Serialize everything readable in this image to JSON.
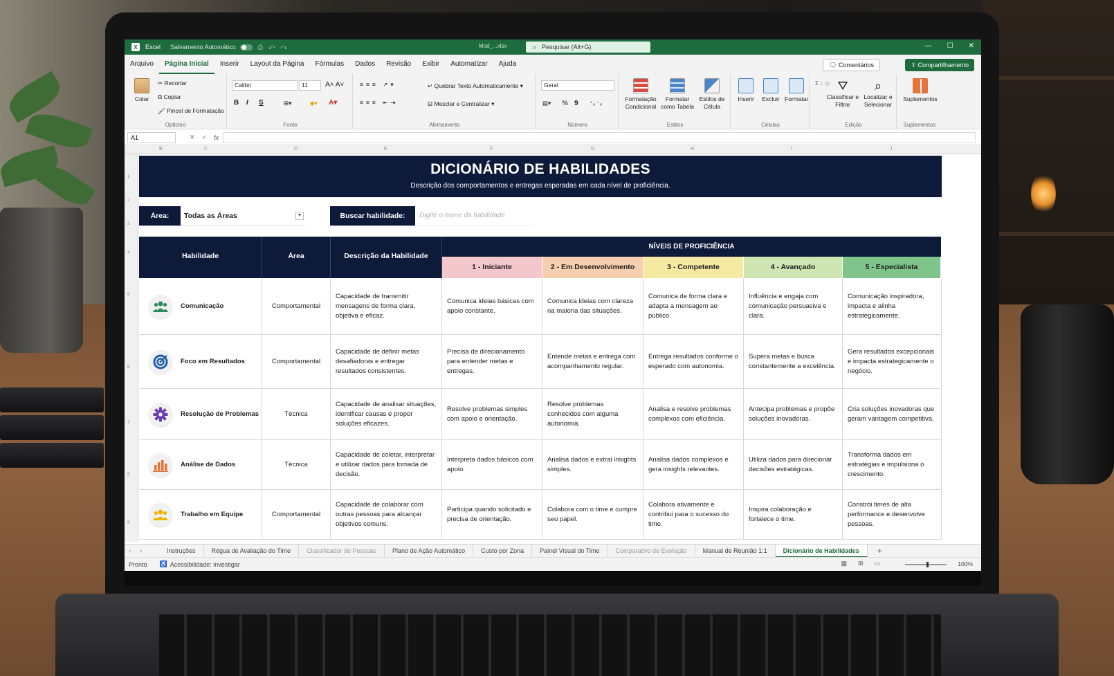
{
  "window": {
    "app_name": "Excel",
    "autosave_label": "Salvamento Automático",
    "file_name": "Mod_...xlsx",
    "search_placeholder": "Pesquisar (Alt+G)",
    "win_min": "—",
    "win_max": "☐",
    "win_close": "✕"
  },
  "menu": {
    "tabs": [
      "Arquivo",
      "Página Inicial",
      "Inserir",
      "Layout da Página",
      "Fórmulas",
      "Dados",
      "Revisão",
      "Exibir",
      "Automatizar",
      "Ajuda"
    ],
    "active_tab": "Página Inicial",
    "comments_label": "Comentários",
    "share_label": "Compartilhamento"
  },
  "ribbon": {
    "paste": "Colar",
    "cut": "Recortar",
    "copy": "Copiar",
    "format_painter": "Pincel de Formatação",
    "clipboard_group": "Opticteo",
    "font_name": "Calibri",
    "font_size": "11",
    "bold": "B",
    "italic": "I",
    "underline": "S",
    "font_group": "Fonte",
    "wrap_text": "Quebrar Texto Automaticamente",
    "merge_center": "Mesclar e Centralizar",
    "alignment_group": "Alinhamento",
    "number_format": "Geral",
    "percent": "%",
    "thousands": "9",
    "number_group": "Número",
    "cond_format": "Formatação Condicional",
    "format_table": "Formatar como Tabela",
    "cell_styles": "Estilos de Célula",
    "styles_group": "Estilos",
    "insert": "Inserir",
    "delete": "Excluir",
    "format": "Formatar",
    "cells_group": "Células",
    "sort_filter": "Classificar e Filtrar",
    "find_select": "Localizar e Selecionar",
    "editing_group": "Edição",
    "addins": "Suplementos",
    "addins_group": "Suplementos"
  },
  "formula_bar": {
    "name_box": "A1",
    "fx_label": "fx"
  },
  "sheet": {
    "title": "DICIONÁRIO DE HABILIDADES",
    "subtitle": "Descrição dos comportamentos e entregas esperadas em cada nível de proficiência.",
    "area_label": "Área:",
    "area_value": "Todas as Áreas",
    "search_label": "Buscar habilidade:",
    "search_placeholder": "Digite o nome da habilidade",
    "headers": {
      "skill": "Habilidade",
      "area": "Área",
      "description": "Descrição da Habilidade",
      "levels_title": "NÍVEIS DE PROFICIÊNCIA"
    },
    "levels": [
      {
        "label": "1 - Iniciante",
        "color": "#f4c7cc"
      },
      {
        "label": "2 - Em Desenvolvimento",
        "color": "#f8cfae"
      },
      {
        "label": "3 - Competente",
        "color": "#f6eaa3"
      },
      {
        "label": "4 - Avançado",
        "color": "#cfe6b3"
      },
      {
        "label": "5 - Especialista",
        "color": "#7fc48a"
      }
    ],
    "rows": [
      {
        "skill": "Comunicação",
        "icon": "people-icon",
        "area": "Comportamental",
        "description": "Capacidade de transmitir mensagens de forma clara, objetiva e eficaz.",
        "l1": "Comunica ideias básicas com apoio constante.",
        "l2": "Comunica ideias com clareza na maioria das situações.",
        "l3": "Comunica de forma clara e adapta a mensagem ao público.",
        "l4": "Influência e engaja com comunicação persuasiva e clara.",
        "l5": "Comunicação inspiradora, impacta e alinha estrategicamente."
      },
      {
        "skill": "Foco em Resultados",
        "icon": "target-icon",
        "area": "Comportamental",
        "description": "Capacidade de definir metas desafiadoras e entregar resultados consistentes.",
        "l1": "Precisa de direcionamento para entender metas e entregas.",
        "l2": "Entende metas e entrega com acompanhamento regular.",
        "l3": "Entrega resultados conforme o esperado com autonomia.",
        "l4": "Supera metas e busca constantemente a excelência.",
        "l5": "Gera resultados excepcionais e impacta estrategicamente o negócio."
      },
      {
        "skill": "Resolução de Problemas",
        "icon": "gear-icon",
        "area": "Técnica",
        "description": "Capacidade de analisar situações, identificar causas e propor soluções eficazes.",
        "l1": "Resolve problemas simples com apoio e orientação.",
        "l2": "Resolve problemas conhecidos com alguma autonomia.",
        "l3": "Analisa e resolve problemas complexos com eficiência.",
        "l4": "Antecipa problemas e propõe soluções inovadoras.",
        "l5": "Cria soluções inovadoras que geram vantagem competitiva."
      },
      {
        "skill": "Análise de Dados",
        "icon": "bar-chart-icon",
        "area": "Técnica",
        "description": "Capacidade de coletar, interpretar e utilizar dados para tomada de decisão.",
        "l1": "Interpreta dados básicos com apoio.",
        "l2": "Analisa dados e extrai insights simples.",
        "l3": "Analisa dados complexos e gera insights relevantes.",
        "l4": "Utiliza dados para direcionar decisões estratégicas.",
        "l5": "Transforma dados em estratégias e impulsiona o crescimento."
      },
      {
        "skill": "Trabalho em Equipe",
        "icon": "team-icon",
        "area": "Comportamental",
        "description": "Capacidade de colaborar com outras pessoas para alcançar objetivos comuns.",
        "l1": "Participa quando solicitado e precisa de orientação.",
        "l2": "Colabora com o time e cumpre seu papel.",
        "l3": "Colabora ativamente e contribui para o sucesso do time.",
        "l4": "Inspira colaboração e fortalece o time.",
        "l5": "Constrói times de alta performance e desenvolve pessoas."
      }
    ]
  },
  "sheet_tabs": [
    {
      "label": "Instruções",
      "state": "normal"
    },
    {
      "label": "Régua de Avaliação do Time",
      "state": "normal"
    },
    {
      "label": "Classificador de Pessoas",
      "state": "dim"
    },
    {
      "label": "Plano de Ação Automático",
      "state": "normal"
    },
    {
      "label": "Custo por Zona",
      "state": "normal"
    },
    {
      "label": "Painel Visual do Time",
      "state": "normal"
    },
    {
      "label": "Comparativo de Evolução",
      "state": "dim"
    },
    {
      "label": "Manual de Reunião 1:1",
      "state": "normal"
    },
    {
      "label": "Dicionário de Habilidades",
      "state": "active"
    }
  ],
  "status": {
    "ready": "Pronto",
    "accessibility": "Acessibilidade: investigar",
    "zoom": "100%"
  },
  "colors": {
    "excel_green": "#1e6b3e",
    "navy": "#0e1a3a"
  }
}
